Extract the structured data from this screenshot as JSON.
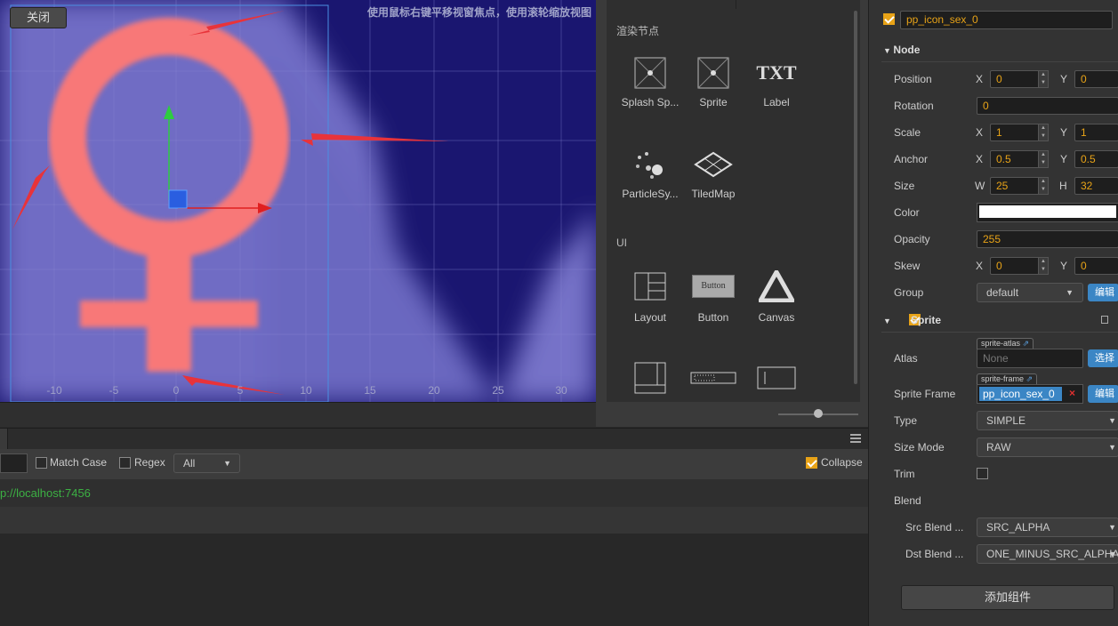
{
  "scene": {
    "close_label": "关闭",
    "hint": "使用鼠标右键平移视窗焦点，使用滚轮缩放视图",
    "axis_labels": [
      "-10",
      "-5",
      "0",
      "5",
      "10",
      "15",
      "20",
      "25",
      "30"
    ]
  },
  "library": {
    "section_render": "渲染节点",
    "section_ui": "UI",
    "render_items": [
      "Splash Sp...",
      "Sprite",
      "Label",
      "ParticleSy...",
      "TiledMap"
    ],
    "ui_items": [
      "Layout",
      "Button",
      "Canvas"
    ],
    "button_preview_text": "Button",
    "label_icon_text": "TXT"
  },
  "console": {
    "match_case": "Match Case",
    "regex": "Regex",
    "filter": "All",
    "collapse": "Collapse",
    "log_line": "p://localhost:7456"
  },
  "inspector": {
    "node_name": "pp_icon_sex_0",
    "node_section": "Node",
    "position": {
      "label": "Position",
      "x": "0",
      "y": "0"
    },
    "rotation": {
      "label": "Rotation",
      "value": "0"
    },
    "scale": {
      "label": "Scale",
      "x": "1",
      "y": "1"
    },
    "anchor": {
      "label": "Anchor",
      "x": "0.5",
      "y": "0.5"
    },
    "size": {
      "label": "Size",
      "w": "25",
      "h": "32"
    },
    "color": {
      "label": "Color",
      "value": "#ffffff"
    },
    "opacity": {
      "label": "Opacity",
      "value": "255"
    },
    "skew": {
      "label": "Skew",
      "x": "0",
      "y": "0"
    },
    "group": {
      "label": "Group",
      "value": "default",
      "button": "编辑"
    },
    "axis": {
      "x": "X",
      "y": "Y",
      "w": "W",
      "h": "H"
    },
    "sprite_section": "Sprite",
    "atlas": {
      "label": "Atlas",
      "tag": "sprite-atlas",
      "value": "None",
      "button": "选择"
    },
    "sprite_frame": {
      "label": "Sprite Frame",
      "tag": "sprite-frame",
      "value": "pp_icon_sex_0",
      "button": "编辑"
    },
    "type": {
      "label": "Type",
      "value": "SIMPLE"
    },
    "size_mode": {
      "label": "Size Mode",
      "value": "RAW"
    },
    "trim": {
      "label": "Trim"
    },
    "blend": {
      "label": "Blend"
    },
    "src_blend": {
      "label": "Src Blend ...",
      "value": "SRC_ALPHA"
    },
    "dst_blend": {
      "label": "Dst Blend ...",
      "value": "ONE_MINUS_SRC_ALPHA"
    },
    "add_component": "添加组件"
  }
}
